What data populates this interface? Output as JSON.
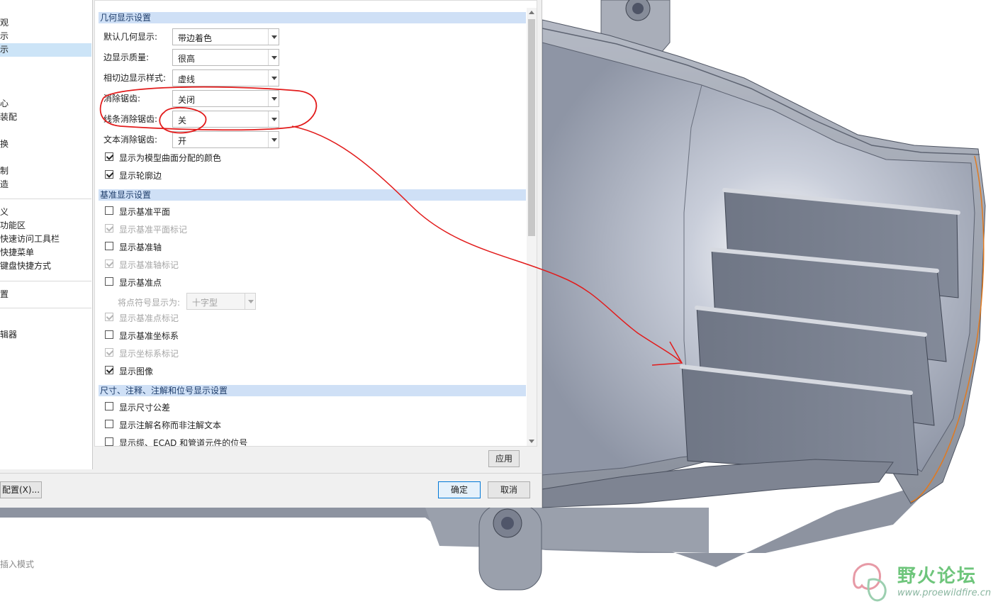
{
  "nav": {
    "items": [
      "观",
      "示",
      "示",
      "心",
      "装配",
      "换",
      "制",
      "造",
      "义",
      "功能区",
      "快速访问工具栏",
      "快捷菜单",
      "键盘快捷方式",
      "置",
      "辑器"
    ]
  },
  "sections": {
    "geometry": "几何显示设置",
    "datum": "基准显示设置",
    "dims": "尺寸、注释、注解和位号显示设置"
  },
  "geometry": {
    "rows": [
      {
        "label": "默认几何显示:",
        "value": "带边着色"
      },
      {
        "label": "边显示质量:",
        "value": "很高"
      },
      {
        "label": "相切边显示样式:",
        "value": "虚线"
      },
      {
        "label": "消除锯齿:",
        "value": "关闭"
      },
      {
        "label": "线条消除锯齿:",
        "value": "关"
      },
      {
        "label": "文本消除锯齿:",
        "value": "开"
      }
    ],
    "checks": [
      {
        "label": "显示为模型曲面分配的颜色",
        "checked": true
      },
      {
        "label": "显示轮廓边",
        "checked": true
      }
    ]
  },
  "datum": {
    "checks": [
      {
        "label": "显示基准平面",
        "checked": false,
        "disabled": false
      },
      {
        "label": "显示基准平面标记",
        "checked": true,
        "disabled": true
      },
      {
        "label": "显示基准轴",
        "checked": false,
        "disabled": false
      },
      {
        "label": "显示基准轴标记",
        "checked": true,
        "disabled": true
      },
      {
        "label": "显示基准点",
        "checked": false,
        "disabled": false
      },
      {
        "label": "显示基准点标记",
        "checked": true,
        "disabled": true
      },
      {
        "label": "显示基准坐标系",
        "checked": false,
        "disabled": false
      },
      {
        "label": "显示坐标系标记",
        "checked": true,
        "disabled": true
      },
      {
        "label": "显示图像",
        "checked": true,
        "disabled": false
      }
    ],
    "point_symbol_label": "将点符号显示为:",
    "point_symbol_value": "十字型"
  },
  "dims": {
    "checks": [
      {
        "label": "显示尺寸公差",
        "checked": false
      },
      {
        "label": "显示注解名称而非注解文本",
        "checked": false
      },
      {
        "label": "显示缆、ECAD 和管道元件的位号",
        "checked": false
      }
    ]
  },
  "buttons": {
    "apply": "应用",
    "ok": "确定",
    "cancel": "取消",
    "config": "配置(X)..."
  },
  "status": "插入模式",
  "watermark": {
    "title": "野火论坛",
    "url": "www.proewildfire.cn"
  }
}
